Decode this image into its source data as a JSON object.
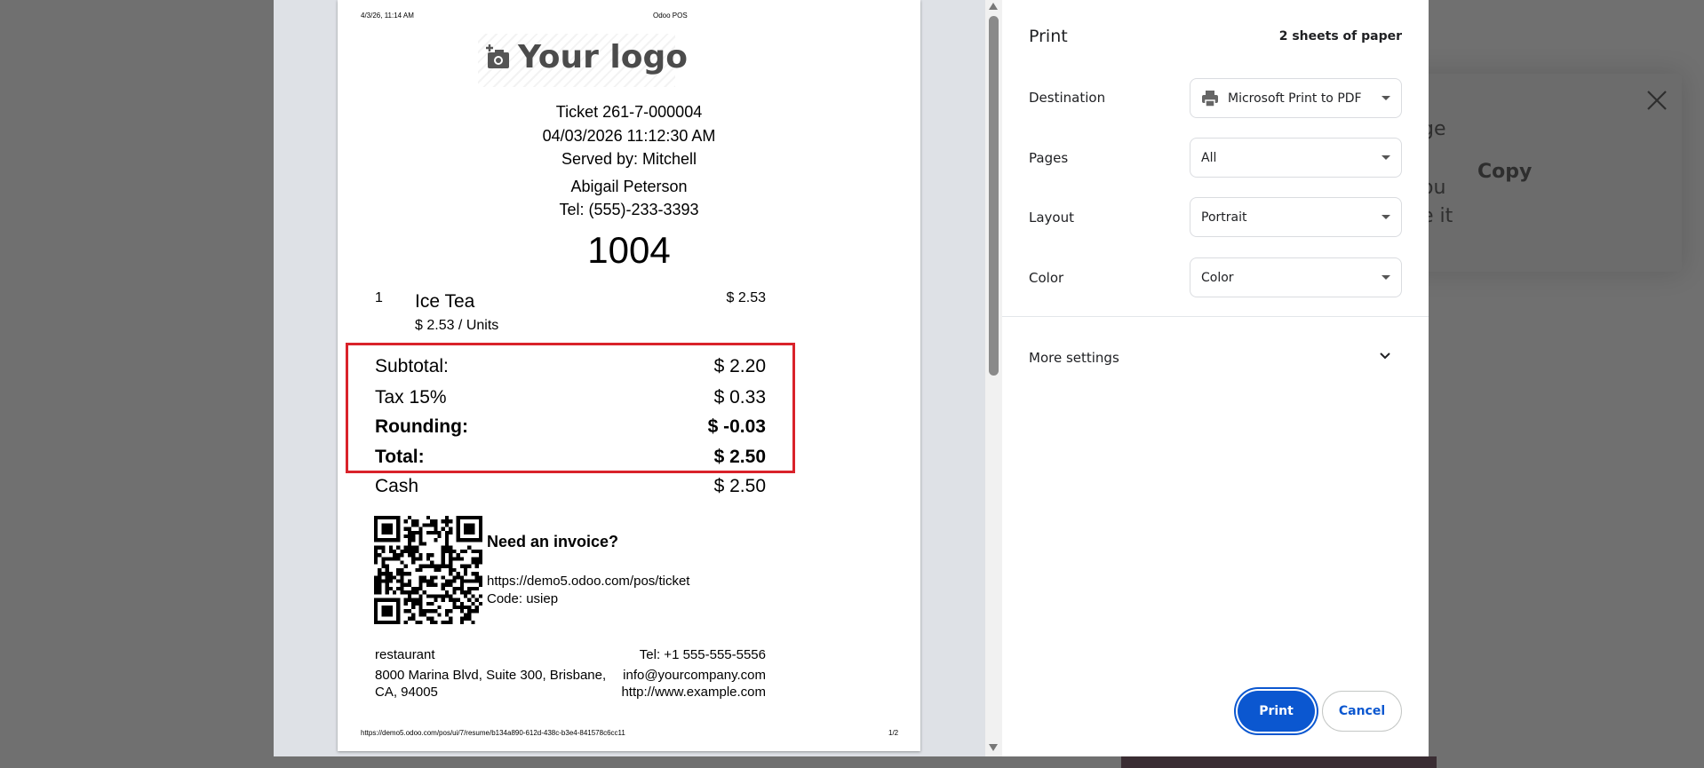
{
  "background_dialog": {
    "text_fragments": [
      "ge",
      "ou",
      "e it"
    ],
    "copy_label": "Copy",
    "close_icon": "close-icon"
  },
  "receipt": {
    "header_datetime": "4/3/26, 11:14 AM",
    "header_title": "Odoo POS",
    "logo_text": "Your logo",
    "ticket": "Ticket 261-7-000004",
    "datetime": "04/03/2026 11:12:30 AM",
    "served_by": "Served by: Mitchell",
    "customer": "Abigail Peterson",
    "customer_tel": "Tel: (555)-233-3393",
    "order_number": "1004",
    "lines": [
      {
        "qty": "1",
        "name": "Ice Tea",
        "price": "$ 2.53",
        "unit_price": "$ 2.53 / Units"
      }
    ],
    "totals": {
      "subtotal_label": "Subtotal:",
      "subtotal": "$ 2.20",
      "tax_label": "Tax 15%",
      "tax": "$ 0.33",
      "rounding_label": "Rounding:",
      "rounding": "$ -0.03",
      "total_label": "Total:",
      "total": "$ 2.50"
    },
    "payment": {
      "label": "Cash",
      "amount": "$ 2.50"
    },
    "invoice": {
      "title": "Need an invoice?",
      "url": "https://demo5.odoo.com/pos/ticket",
      "code": "Code: usiep"
    },
    "company": {
      "name": "restaurant",
      "address1": "8000 Marina Blvd, Suite 300, Brisbane,",
      "address2": "CA, 94005",
      "tel": "Tel: +1 555-555-5556",
      "email": "info@yourcompany.com",
      "website": "http://www.example.com"
    },
    "footer_url": "https://demo5.odoo.com/pos/ui/7/resume/b134a890-612d-438c-b3e4-841578c6cc11",
    "page": "1/2",
    "highlight_color": "#d9222a"
  },
  "print": {
    "title": "Print",
    "sheets": "2 sheets of paper",
    "destination_label": "Destination",
    "destination": "Microsoft Print to PDF",
    "pages_label": "Pages",
    "pages": "All",
    "layout_label": "Layout",
    "layout": "Portrait",
    "color_label": "Color",
    "color": "Color",
    "more_settings": "More settings",
    "print_button": "Print",
    "cancel_button": "Cancel",
    "accent": "#0b57d0"
  }
}
